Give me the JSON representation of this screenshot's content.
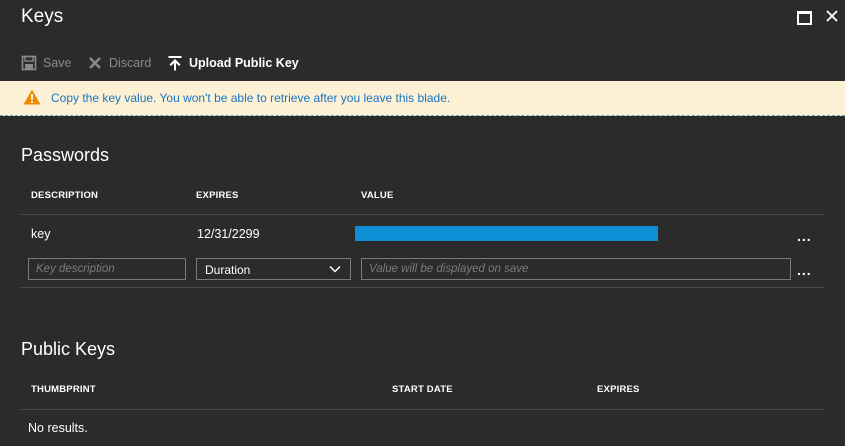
{
  "window": {
    "title": "Keys",
    "maximize_icon": "maximize-icon",
    "close_icon": "close-icon"
  },
  "toolbar": {
    "save_label": "Save",
    "discard_label": "Discard",
    "upload_label": "Upload Public Key"
  },
  "banner": {
    "icon": "warning-icon",
    "message": "Copy the key value. You won't be able to retrieve after you leave this blade.",
    "bg_color": "#fcf1d5",
    "text_color": "#1a75c4"
  },
  "passwords": {
    "title": "Passwords",
    "columns": [
      "DESCRIPTION",
      "EXPIRES",
      "VALUE"
    ],
    "rows": [
      {
        "description": "key",
        "expires": "12/31/2299",
        "value_color": "#0d8fd6"
      }
    ],
    "new_row": {
      "description_placeholder": "Key description",
      "duration_selected": "Duration",
      "value_placeholder": "Value will be displayed on save"
    },
    "more_label": "..."
  },
  "public_keys": {
    "title": "Public Keys",
    "columns": [
      "THUMBPRINT",
      "START DATE",
      "EXPIRES"
    ],
    "empty_message": "No results."
  }
}
